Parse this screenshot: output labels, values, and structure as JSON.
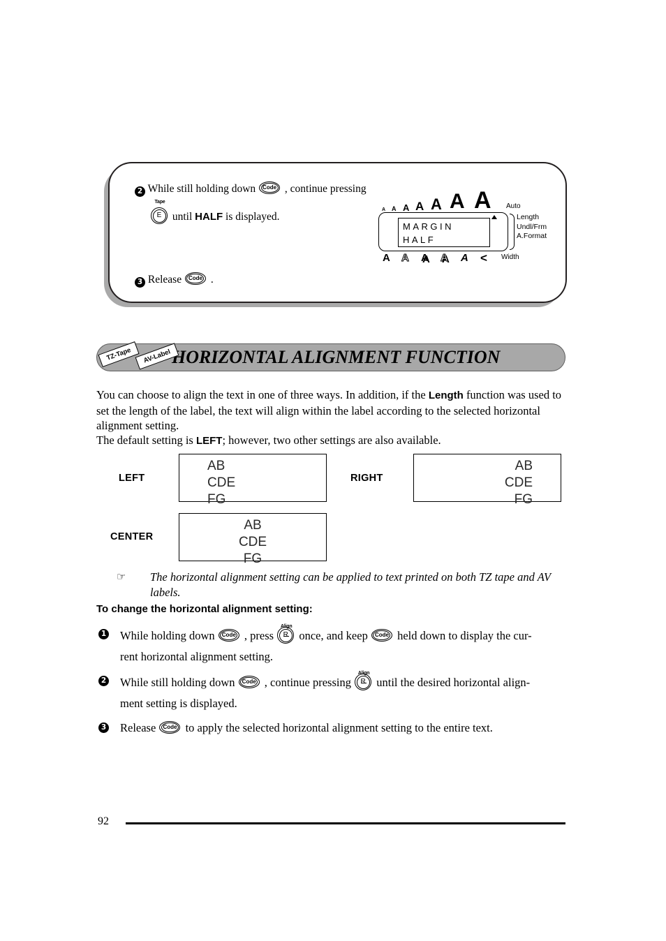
{
  "page": {
    "number": "92"
  },
  "callout": {
    "steps": [
      {
        "num": "2",
        "text_before": "While still holding down",
        "key1": "Code",
        "text_mid": ", continue pressing",
        "key2_top": "Tape",
        "key2": "E",
        "text_after_pre": "until",
        "bold_word": "HALF",
        "text_after_post": "is displayed."
      },
      {
        "num": "3",
        "text_before": "Release",
        "key1": "Code",
        "text_mid": "."
      }
    ]
  },
  "lcd": {
    "size_scale": [
      "A",
      "A",
      "A",
      "A",
      "A",
      "A",
      "A"
    ],
    "auto_label": "Auto",
    "screen_line1": "MARGIN",
    "screen_line2": "HALF",
    "side_labels": [
      "Length",
      "Undl/Frm",
      "A.Format"
    ],
    "style_row": [
      "A",
      "A",
      "A",
      "A",
      "A",
      "<"
    ],
    "width_label": "Width"
  },
  "section": {
    "tag_tz": "TZ-Tape",
    "tag_av": "AV-Label",
    "title": "HORIZONTAL ALIGNMENT FUNCTION"
  },
  "body": {
    "p1_a": "You can choose to align the text in one of three ways. In addition, if the ",
    "p1_bold": "Length",
    "p1_b": " function was used to set the length of the label, the text will align within the label according to the selected horizontal alignment setting.",
    "p2_a": "The default setting is ",
    "p2_bold": "LEFT",
    "p2_b": "; however, two other settings are also available."
  },
  "samples": {
    "left": {
      "label": "LEFT",
      "lines": [
        "AB",
        "CDE",
        "FG"
      ]
    },
    "right": {
      "label": "RIGHT",
      "lines": [
        "AB",
        "CDE",
        "FG"
      ]
    },
    "center": {
      "label": "CENTER",
      "lines": [
        "AB",
        "CDE",
        "FG"
      ]
    }
  },
  "note": {
    "icon": "☞",
    "text": "The horizontal alignment setting can be applied to text printed on both TZ tape and AV labels."
  },
  "subhead": "To change the horizontal alignment setting:",
  "instructions": [
    {
      "num": "1",
      "seg1": "While holding down",
      "key1": "Code",
      "seg2": ", press",
      "key2_top": "Align",
      "key2": "R",
      "seg3": "once, and keep",
      "key3": "Code",
      "seg4": "held down to display the cur-",
      "cont": "rent horizontal alignment setting."
    },
    {
      "num": "2",
      "seg1": "While still holding down",
      "key1": "Code",
      "seg2": ", continue pressing",
      "key2_top": "Align",
      "key2": "R",
      "seg3": "until the desired horizontal align-",
      "cont": "ment setting is displayed."
    },
    {
      "num": "3",
      "seg1": "Release",
      "key1": "Code",
      "seg2": "to apply the selected horizontal alignment setting to the entire text."
    }
  ],
  "colors": {
    "heading_bar": "#a8a8a8",
    "shadow": "#a9a9a9"
  }
}
